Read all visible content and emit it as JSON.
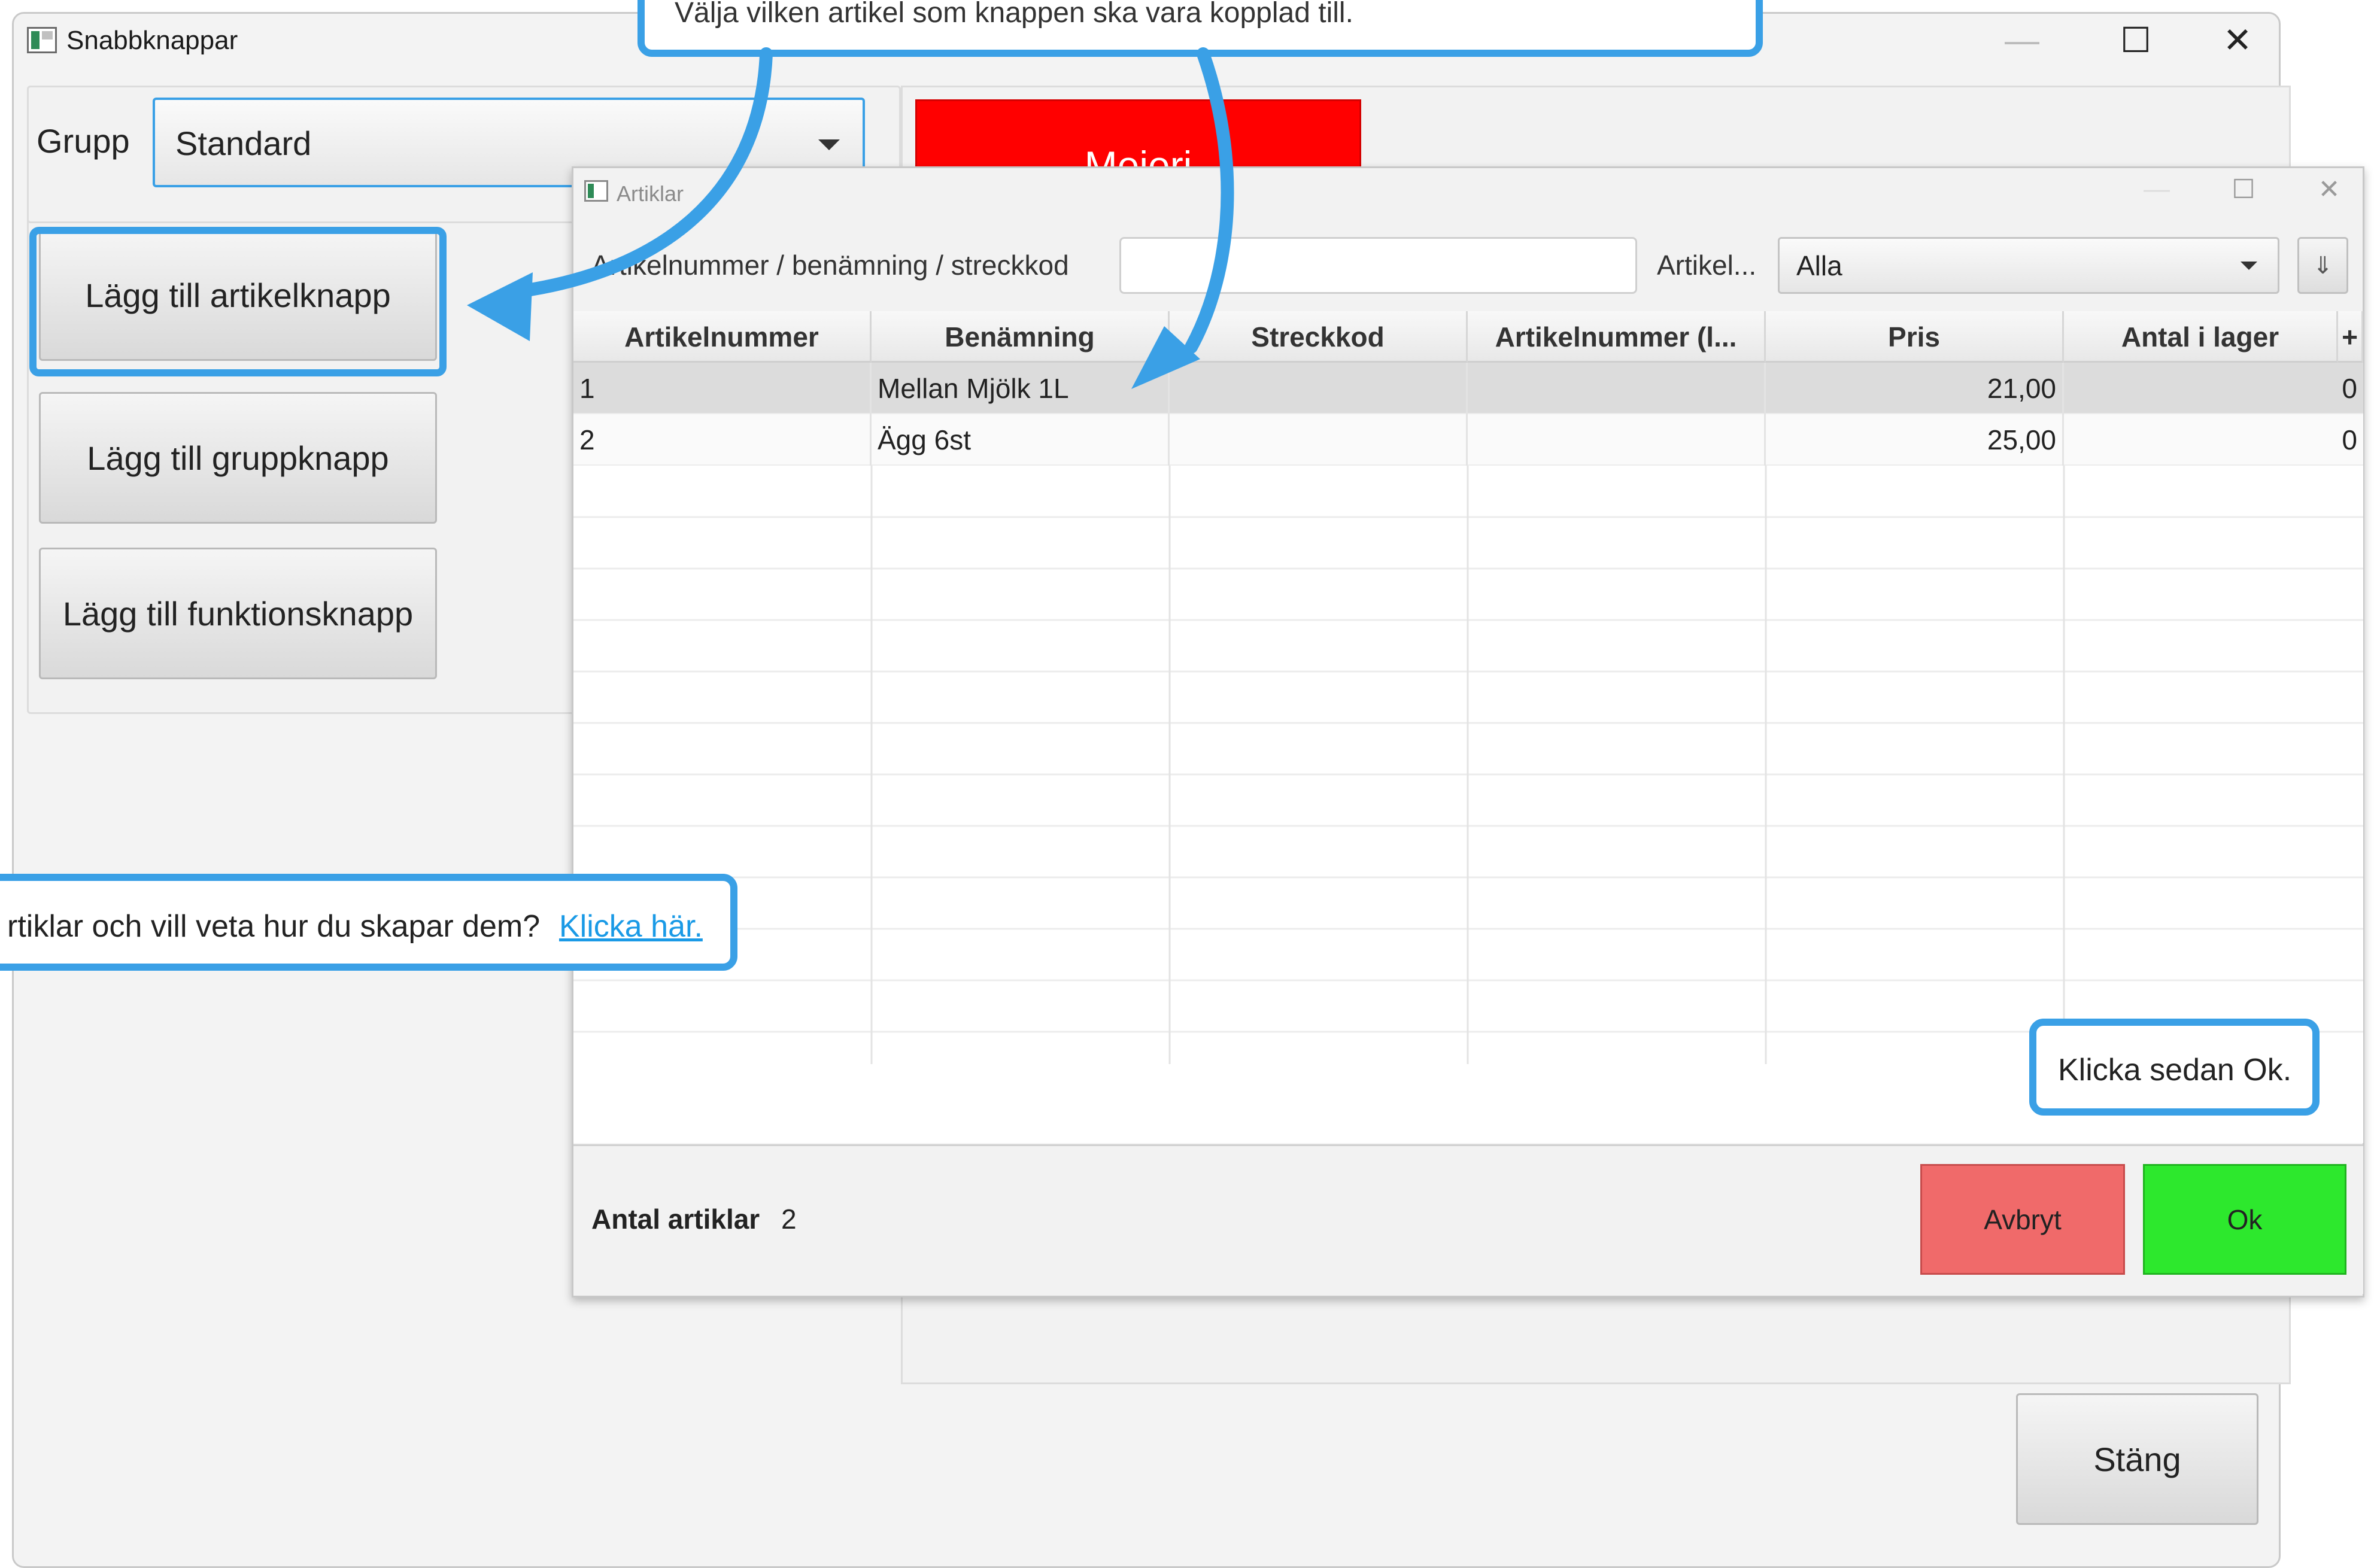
{
  "main_window": {
    "title": "Snabbknappar",
    "icon": "app-window-icon",
    "controls": {
      "minimize": "—",
      "maximize": "☐",
      "close": "✕"
    }
  },
  "group": {
    "label": "Grupp",
    "selected": "Standard"
  },
  "left_buttons": {
    "add_article": "Lägg till artikelknapp",
    "add_group": "Lägg till gruppknapp",
    "add_function": "Lägg till funktionsknapp"
  },
  "quick_button": {
    "label": "Mejeri",
    "color": "#ff0000"
  },
  "close_button": "Stäng",
  "dialog": {
    "title": "Artiklar",
    "search_label": "Artikelnummer / benämning / streckkod",
    "search_value": "",
    "filter_label": "Artikel...",
    "filter_selected": "Alla",
    "sort_icon": "⇓",
    "columns": [
      "Artikelnummer",
      "Benämning",
      "Streckkod",
      "Artikelnummer (l...",
      "Pris",
      "Antal i lager",
      "+"
    ],
    "rows": [
      {
        "artnr": "1",
        "name": "Mellan Mjölk 1L",
        "barcode": "",
        "artnr_l": "",
        "price": "21,00",
        "stock": "0"
      },
      {
        "artnr": "2",
        "name": "Ägg 6st",
        "barcode": "",
        "artnr_l": "",
        "price": "25,00",
        "stock": "0"
      }
    ],
    "footer_label": "Antal artiklar",
    "footer_count": "2",
    "cancel": "Avbryt",
    "ok": "Ok"
  },
  "callouts": {
    "top": "Välja vilken artikel som knappen ska vara kopplad till.",
    "left_text": "rtiklar och vill veta hur du skapar dem?",
    "left_link": "Klicka här.",
    "ok_hint": "Klicka sedan Ok."
  },
  "colors": {
    "accent": "#3aa0e6",
    "cancel": "#f06a6a",
    "ok": "#2de82d"
  }
}
